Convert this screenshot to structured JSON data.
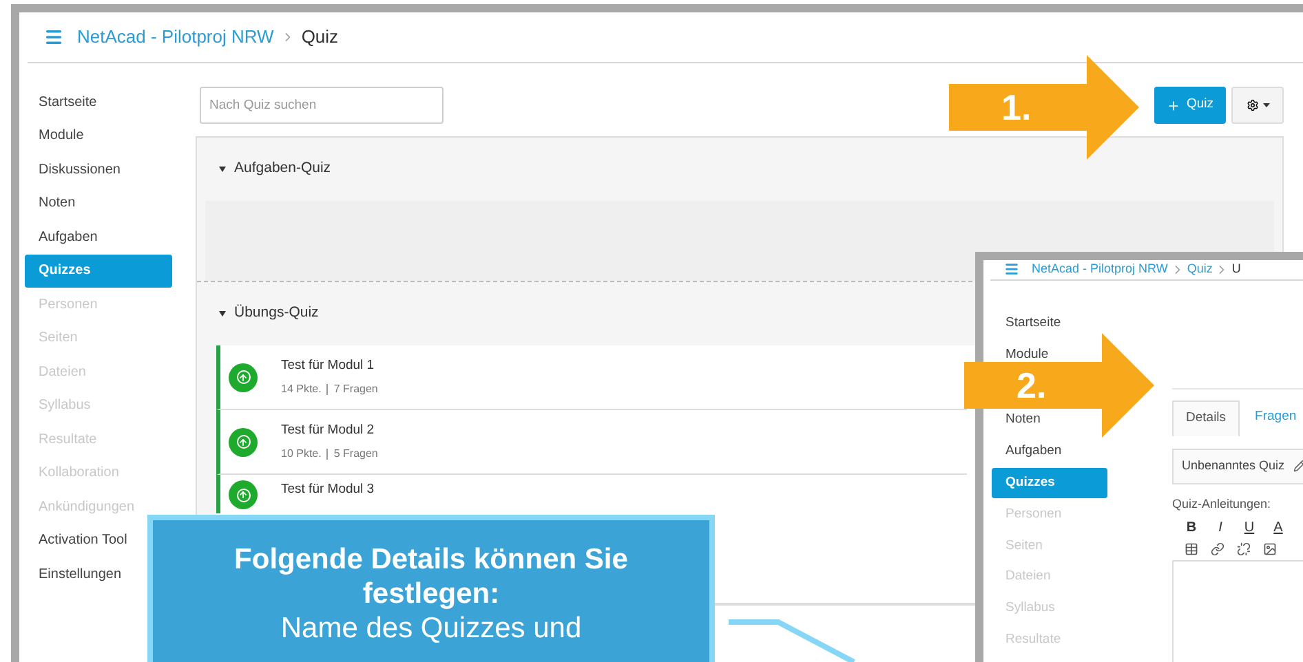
{
  "main_window": {
    "breadcrumb": [
      "NetAcad - Pilotproj NRW",
      "Quiz"
    ],
    "sidebar": [
      {
        "label": "Startseite",
        "selected": false,
        "disabled": false
      },
      {
        "label": "Module",
        "selected": false,
        "disabled": false
      },
      {
        "label": "Diskussionen",
        "selected": false,
        "disabled": false
      },
      {
        "label": "Noten",
        "selected": false,
        "disabled": false
      },
      {
        "label": "Aufgaben",
        "selected": false,
        "disabled": false
      },
      {
        "label": "Quizzes",
        "selected": true,
        "disabled": false
      },
      {
        "label": "Personen",
        "selected": false,
        "disabled": true
      },
      {
        "label": "Seiten",
        "selected": false,
        "disabled": true
      },
      {
        "label": "Dateien",
        "selected": false,
        "disabled": true
      },
      {
        "label": "Syllabus",
        "selected": false,
        "disabled": true
      },
      {
        "label": "Resultate",
        "selected": false,
        "disabled": true
      },
      {
        "label": "Kollaboration",
        "selected": false,
        "disabled": true
      },
      {
        "label": "Ankündigungen",
        "selected": false,
        "disabled": true
      },
      {
        "label": "Activation Tool",
        "selected": false,
        "disabled": false
      },
      {
        "label": "Einstellungen",
        "selected": false,
        "disabled": false
      }
    ],
    "search": {
      "placeholder": "Nach Quiz suchen"
    },
    "new_quiz_button": "Quiz",
    "sections": [
      {
        "title": "Aufgaben-Quiz",
        "expanded": true
      },
      {
        "title": "Übungs-Quiz",
        "expanded": true,
        "items": [
          {
            "title": "Test für Modul 1",
            "points": "14 Pkte.",
            "questions": "7 Fragen",
            "published": true
          },
          {
            "title": "Test für Modul 2",
            "points": "10 Pkte.",
            "questions": "5 Fragen",
            "published": true
          },
          {
            "title": "Test für Modul 3",
            "published": true
          }
        ]
      }
    ]
  },
  "second_window": {
    "breadcrumb": [
      "NetAcad - Pilotproj NRW",
      "Quiz",
      "U"
    ],
    "sidebar": [
      {
        "label": "Startseite",
        "selected": false,
        "disabled": false
      },
      {
        "label": "Module",
        "selected": false,
        "disabled": false
      },
      {
        "label": "Noten",
        "selected": false,
        "disabled": false
      },
      {
        "label": "Aufgaben",
        "selected": false,
        "disabled": false
      },
      {
        "label": "Quizzes",
        "selected": true,
        "disabled": false
      },
      {
        "label": "Personen",
        "selected": false,
        "disabled": true
      },
      {
        "label": "Seiten",
        "selected": false,
        "disabled": true
      },
      {
        "label": "Dateien",
        "selected": false,
        "disabled": true
      },
      {
        "label": "Syllabus",
        "selected": false,
        "disabled": true
      },
      {
        "label": "Resultate",
        "selected": false,
        "disabled": true
      }
    ],
    "tabs": [
      {
        "label": "Details",
        "selected": true
      },
      {
        "label": "Fragen",
        "selected": false
      }
    ],
    "quiz_name": "Unbenanntes Quiz",
    "instructions_label": "Quiz-Anleitungen:",
    "format_buttons": [
      "B",
      "I",
      "U",
      "A"
    ]
  },
  "annotations": {
    "steps": [
      "1.",
      "2."
    ],
    "callout": {
      "title": "Folgende Details können Sie festlegen:",
      "text": "Name des Quizzes und"
    }
  }
}
